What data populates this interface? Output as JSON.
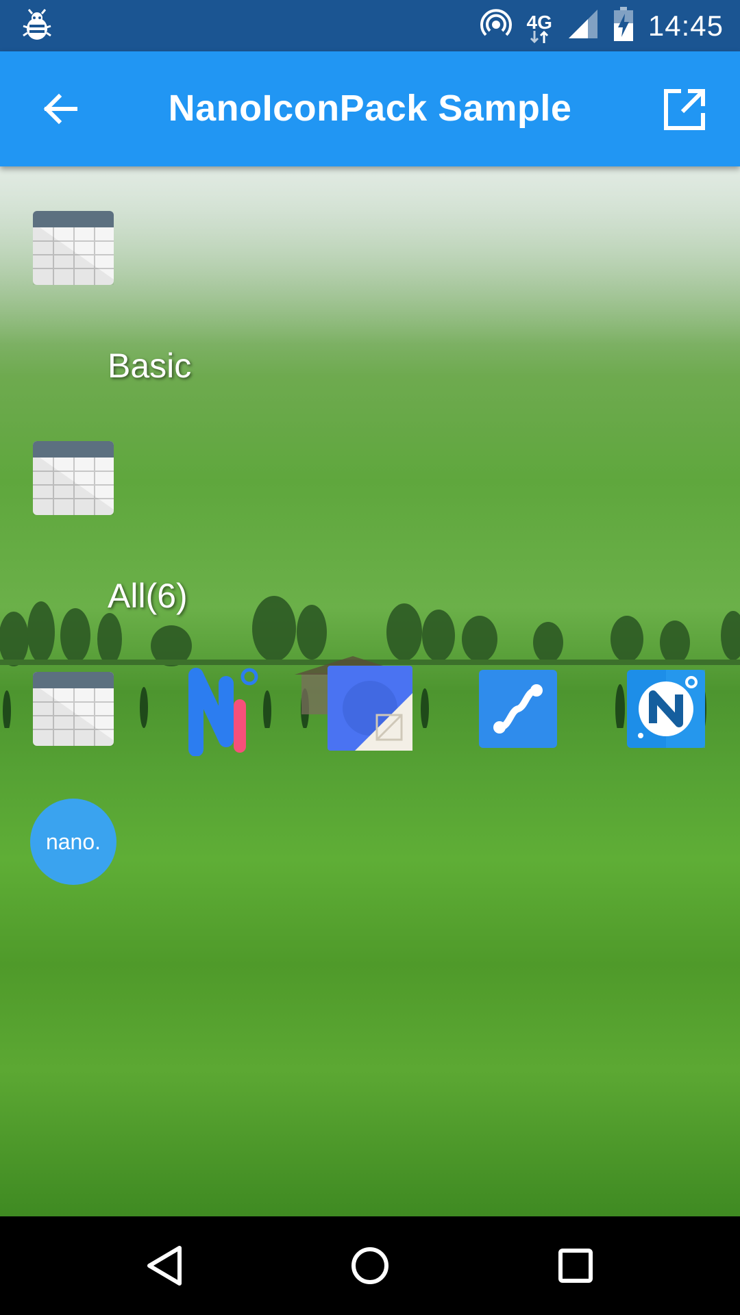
{
  "status_bar": {
    "time": "14:45",
    "network": "4G",
    "icons": [
      "bug-icon",
      "hotspot-icon",
      "network-4g-icon",
      "signal-icon",
      "battery-charging-icon"
    ]
  },
  "app_bar": {
    "title": "NanoIconPack Sample",
    "back_icon": "arrow-back-icon",
    "action_icon": "open-in-new-icon"
  },
  "sections": [
    {
      "label": "Basic"
    },
    {
      "label": "All(6)"
    }
  ],
  "icons": {
    "row1": "spreadsheet-icon",
    "row2": "spreadsheet-icon",
    "all": [
      "spreadsheet-icon",
      "ni-logo-icon",
      "blue-square-icon",
      "path-icon",
      "n-circle-icon",
      "nano-icon"
    ]
  },
  "nano_text": "nano.",
  "colors": {
    "status_bar": "#1b5592",
    "app_bar": "#2196f3",
    "nano_bg": "#3aa3ef",
    "accent_pink": "#f7507a"
  },
  "nav_bar": {
    "buttons": [
      "back-triangle-icon",
      "home-circle-icon",
      "recents-square-icon"
    ]
  }
}
